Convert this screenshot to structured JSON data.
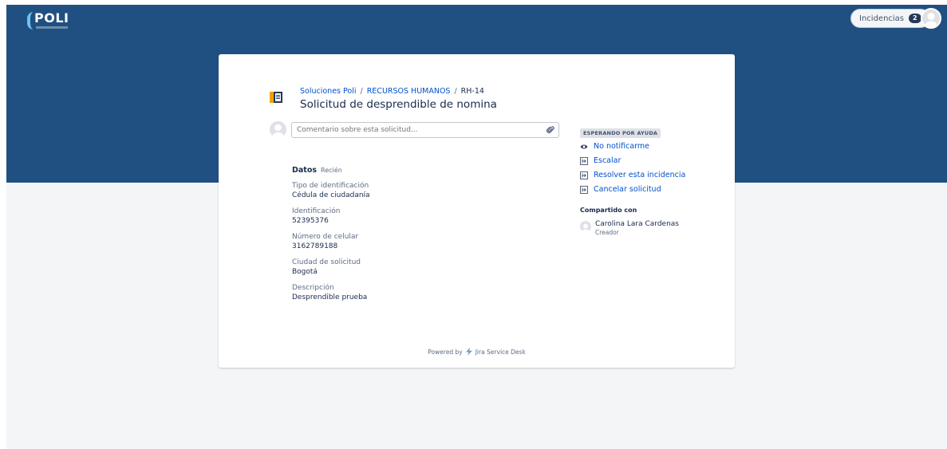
{
  "header": {
    "logo_text": "POLI",
    "issues_label": "Incidencias",
    "issues_count": "2"
  },
  "request": {
    "breadcrumb": [
      "Soluciones Poli",
      "RECURSOS HUMANOS",
      "RH-14"
    ],
    "breadcrumb_sep": "/",
    "title": "Solicitud de desprendible de nomina"
  },
  "comment": {
    "placeholder": "Comentario sobre esta solicitud..."
  },
  "details": {
    "title": "Datos",
    "time": "Recién",
    "fields": [
      {
        "label": "Tipo de identificación",
        "value": "Cédula de ciudadanía"
      },
      {
        "label": "Identificación",
        "value": "52395376"
      },
      {
        "label": "Número de celular",
        "value": "3162789188"
      },
      {
        "label": "Ciudad de solicitud",
        "value": "Bogotá"
      },
      {
        "label": "Descripción",
        "value": "Desprendible prueba"
      }
    ]
  },
  "sidebar": {
    "status": "ESPERANDO POR AYUDA",
    "notify_label": "No notificarme",
    "actions": [
      "Escalar",
      "Resolver esta incidencia",
      "Cancelar solicitud"
    ],
    "shared_with_title": "Compartido con",
    "participant_name": "Carolina Lara Cardenas",
    "participant_role": "Creador"
  },
  "footer": {
    "powered_by": "Powered by",
    "product": "Jira Service Desk"
  },
  "colors": {
    "banner": "#205081",
    "link": "#0052cc",
    "text": "#172b4d",
    "muted": "#5e6c84"
  }
}
